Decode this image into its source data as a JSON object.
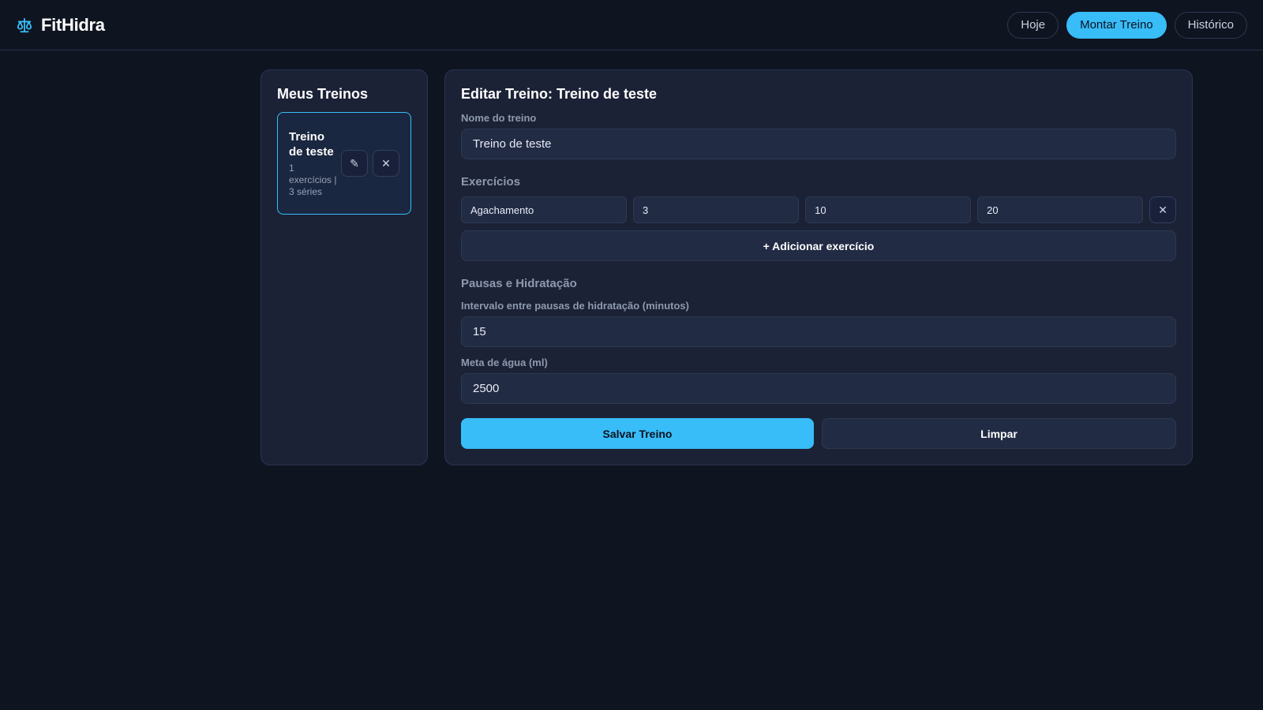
{
  "header": {
    "brand": "FitHidra",
    "brand_icon": "scale-icon",
    "accent_color": "#38bdf8",
    "nav": [
      {
        "label": "Hoje"
      },
      {
        "label": "Montar Treino",
        "active": true
      },
      {
        "label": "Histórico"
      }
    ]
  },
  "sidebar": {
    "title": "Meus Treinos",
    "workouts": [
      {
        "name": "Treino de teste",
        "meta": "1 exercícios | 3 séries",
        "edit_icon": "✎",
        "delete_icon": "✕"
      }
    ]
  },
  "editor": {
    "title": "Editar Treino: Treino de teste",
    "name_label": "Nome do treino",
    "name_value": "Treino de teste",
    "exercises_title": "Exercícios",
    "exercises": [
      {
        "name": "Agachamento",
        "sets": "3",
        "reps": "10",
        "weight": "20"
      }
    ],
    "remove_icon": "✕",
    "add_exercise_label": "+ Adicionar exercício",
    "hydration_title": "Pausas e Hidratação",
    "interval_label": "Intervalo entre pausas de hidratação (minutos)",
    "interval_value": "15",
    "water_label": "Meta de água (ml)",
    "water_value": "2500",
    "save_label": "Salvar Treino",
    "clear_label": "Limpar"
  }
}
